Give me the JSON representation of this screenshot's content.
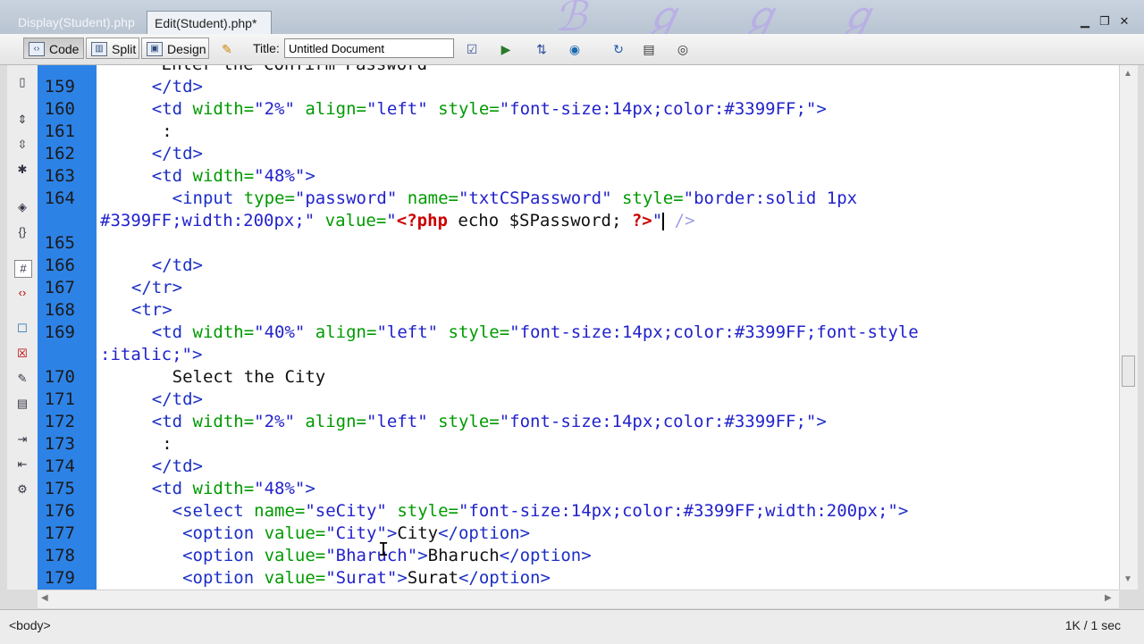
{
  "tabs": [
    "Display(Student).php",
    "Edit(Student).php*"
  ],
  "toolbar": {
    "code_label": "Code",
    "split_label": "Split",
    "design_label": "Design",
    "title_label": "Title:",
    "title_value": "Untitled Document"
  },
  "icons": {
    "window": [
      "minimize-icon",
      "restore-icon",
      "close-icon"
    ],
    "toolbar": [
      "live-view-icon",
      "validate-icon",
      "preview-icon",
      "file-management-icon",
      "globe-icon",
      "refresh-icon",
      "view-options-icon",
      "visual-aids-icon"
    ],
    "left": [
      "open-documents-icon",
      "collapse-tag-icon",
      "collapse-selection-icon",
      "expand-all-icon",
      "select-parent-tag-icon",
      "balance-braces-icon",
      "line-numbers-icon",
      "highlight-invalid-icon",
      "comment-icon",
      "remove-comment-icon",
      "wrap-tag-icon",
      "recent-snippets-icon",
      "indent-icon",
      "outdent-icon",
      "format-source-icon"
    ]
  },
  "status": {
    "tag": "<body>",
    "size": "1K / 1 sec"
  },
  "colors": {
    "gutter": "#2d82e6",
    "tag": "#1c2fc4",
    "attribute": "#009a00",
    "php": "#cc0000"
  },
  "code_lines": [
    {
      "n": "",
      "segs": [
        [
          "x",
          "      Enter the Confirm Password"
        ]
      ]
    },
    {
      "n": "159",
      "segs": [
        [
          "t",
          "    </td>"
        ]
      ]
    },
    {
      "n": "160",
      "segs": [
        [
          "t",
          "    <td "
        ],
        [
          "a",
          "width="
        ],
        [
          "v",
          "\"2%\""
        ],
        [
          "a",
          " align="
        ],
        [
          "v",
          "\"left\""
        ],
        [
          "a",
          " style="
        ],
        [
          "v",
          "\"font-size:14px;color:#3399FF;\""
        ],
        [
          "t",
          ">"
        ]
      ]
    },
    {
      "n": "161",
      "segs": [
        [
          "x",
          "     :"
        ]
      ]
    },
    {
      "n": "162",
      "segs": [
        [
          "t",
          "    </td>"
        ]
      ]
    },
    {
      "n": "163",
      "segs": [
        [
          "t",
          "    <td "
        ],
        [
          "a",
          "width="
        ],
        [
          "v",
          "\"48%\""
        ],
        [
          "t",
          ">"
        ]
      ]
    },
    {
      "n": "164",
      "segs": [
        [
          "t",
          "      <input "
        ],
        [
          "a",
          "type="
        ],
        [
          "v",
          "\"password\""
        ],
        [
          "a",
          " name="
        ],
        [
          "v",
          "\"txtCSPassword\""
        ],
        [
          "a",
          " style="
        ],
        [
          "v",
          "\"border:solid 1px"
        ]
      ]
    },
    {
      "n": "",
      "segs": [
        [
          "v",
          "#3399FF;width:200px;\""
        ],
        [
          "a",
          " value="
        ],
        [
          "v",
          "\""
        ],
        [
          "p",
          "<?php"
        ],
        [
          "x",
          " echo $SPassword; "
        ],
        [
          "p",
          "?>"
        ],
        [
          "v",
          "\""
        ],
        [
          "caret",
          ""
        ],
        [
          "lg",
          " />"
        ]
      ]
    },
    {
      "n": "165",
      "segs": []
    },
    {
      "n": "166",
      "segs": [
        [
          "t",
          "    </td>"
        ]
      ]
    },
    {
      "n": "167",
      "segs": [
        [
          "t",
          "  </tr>"
        ]
      ]
    },
    {
      "n": "168",
      "segs": [
        [
          "t",
          "  <tr>"
        ]
      ]
    },
    {
      "n": "169",
      "segs": [
        [
          "t",
          "    <td "
        ],
        [
          "a",
          "width="
        ],
        [
          "v",
          "\"40%\""
        ],
        [
          "a",
          " align="
        ],
        [
          "v",
          "\"left\""
        ],
        [
          "a",
          " style="
        ],
        [
          "v",
          "\"font-size:14px;color:#3399FF;font-style"
        ]
      ]
    },
    {
      "n": "",
      "segs": [
        [
          "v",
          ":italic;\""
        ],
        [
          "t",
          ">"
        ]
      ]
    },
    {
      "n": "170",
      "segs": [
        [
          "x",
          "      Select the City"
        ]
      ]
    },
    {
      "n": "171",
      "segs": [
        [
          "t",
          "    </td>"
        ]
      ]
    },
    {
      "n": "172",
      "segs": [
        [
          "t",
          "    <td "
        ],
        [
          "a",
          "width="
        ],
        [
          "v",
          "\"2%\""
        ],
        [
          "a",
          " align="
        ],
        [
          "v",
          "\"left\""
        ],
        [
          "a",
          " style="
        ],
        [
          "v",
          "\"font-size:14px;color:#3399FF;\""
        ],
        [
          "t",
          ">"
        ]
      ]
    },
    {
      "n": "173",
      "segs": [
        [
          "x",
          "     :"
        ]
      ]
    },
    {
      "n": "174",
      "segs": [
        [
          "t",
          "    </td>"
        ]
      ]
    },
    {
      "n": "175",
      "segs": [
        [
          "t",
          "    <td "
        ],
        [
          "a",
          "width="
        ],
        [
          "v",
          "\"48%\""
        ],
        [
          "t",
          ">"
        ]
      ]
    },
    {
      "n": "176",
      "segs": [
        [
          "t",
          "      <select "
        ],
        [
          "a",
          "name="
        ],
        [
          "v",
          "\"seCity\""
        ],
        [
          "a",
          " style="
        ],
        [
          "v",
          "\"font-size:14px;color:#3399FF;width:200px;\""
        ],
        [
          "t",
          ">"
        ]
      ]
    },
    {
      "n": "177",
      "segs": [
        [
          "t",
          "       <option "
        ],
        [
          "a",
          "value="
        ],
        [
          "v",
          "\"City\""
        ],
        [
          "t",
          ">"
        ],
        [
          "x",
          "City"
        ],
        [
          "t",
          "</option>"
        ]
      ]
    },
    {
      "n": "178",
      "segs": [
        [
          "t",
          "       <option "
        ],
        [
          "a",
          "value="
        ],
        [
          "v",
          "\"Bharuch\""
        ],
        [
          "t",
          ">"
        ],
        [
          "x",
          "Bharuch"
        ],
        [
          "t",
          "</option>"
        ]
      ]
    },
    {
      "n": "179",
      "segs": [
        [
          "t",
          "       <option "
        ],
        [
          "a",
          "value="
        ],
        [
          "v",
          "\"Surat\""
        ],
        [
          "t",
          ">"
        ],
        [
          "x",
          "Surat"
        ],
        [
          "t",
          "</option>"
        ]
      ]
    }
  ]
}
